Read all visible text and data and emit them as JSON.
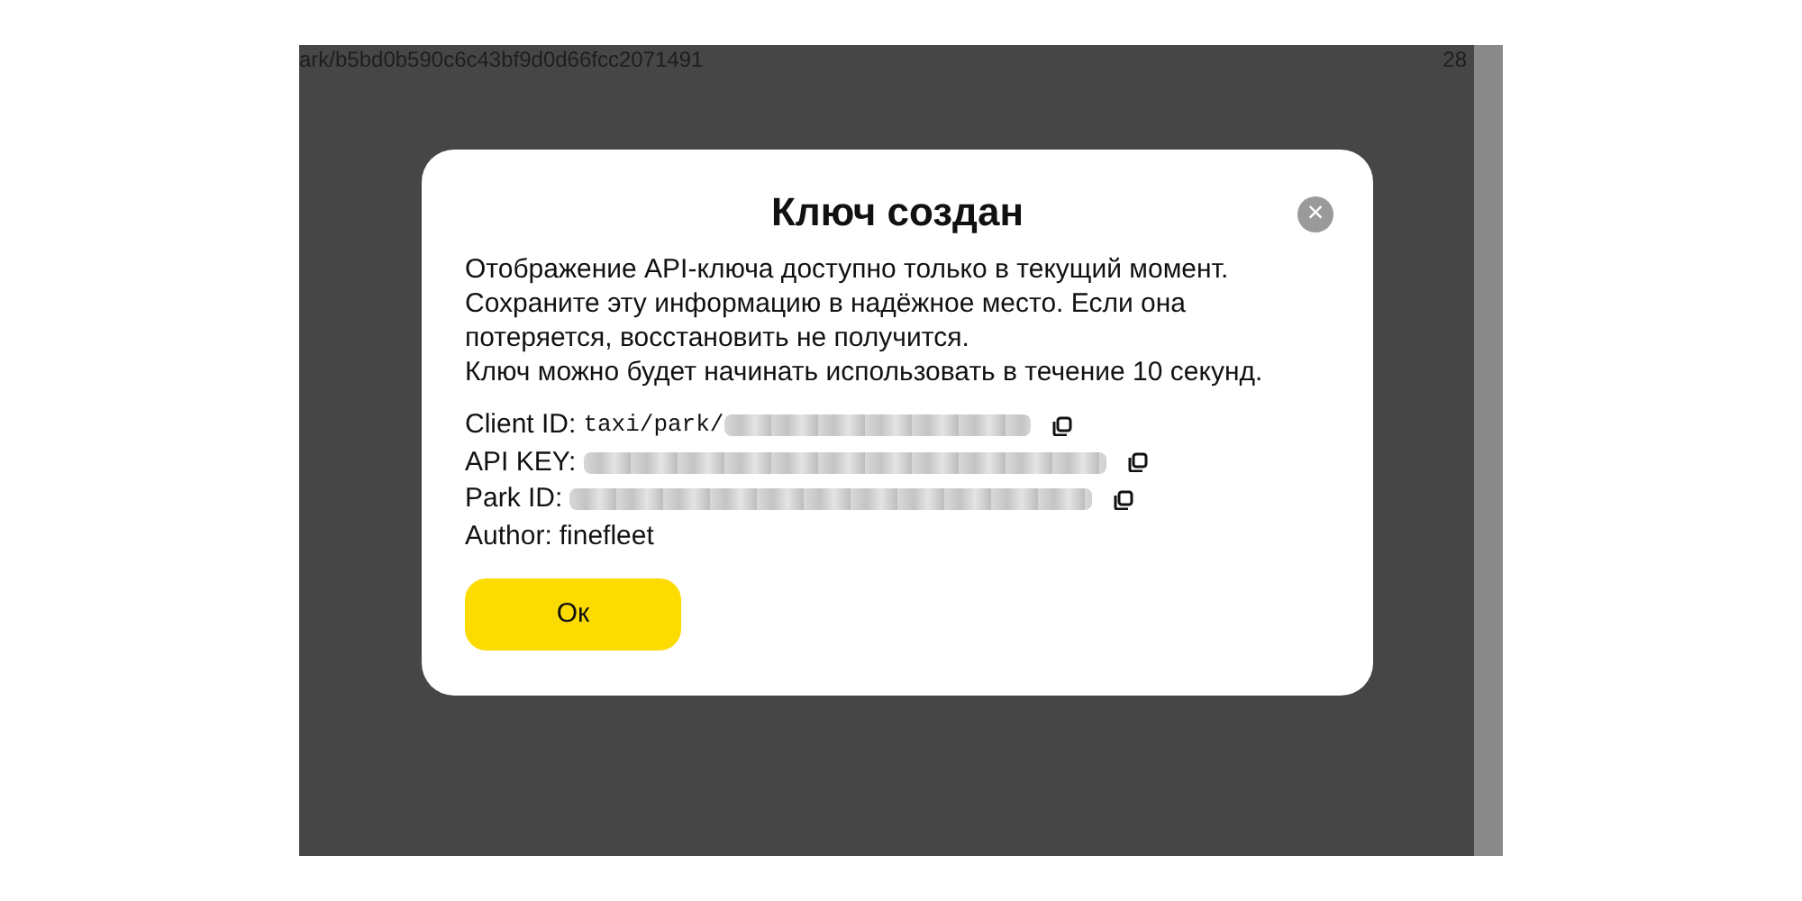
{
  "background_page": {
    "address": "ark/b5bd0b590c6c43bf9d0d66fcc2071491",
    "column_2": "28"
  },
  "dialog": {
    "title": "Ключ создан",
    "close": "×",
    "message": [
      "Отображение API-ключа доступно только в текущий момент.",
      "Сохраните эту информацию в надёжное место. Если она потеряется, восстановить не получится.",
      "Ключ можно будет начинать использовать в течение 10 секунд."
    ],
    "fields": [
      {
        "label": "Client ID:",
        "value": "taxi/park/",
        "redacted": true,
        "copyable": true
      },
      {
        "label": "API KEY:",
        "redacted": true,
        "copyable": true
      },
      {
        "label": "Park ID:",
        "redacted": true,
        "copyable": true
      },
      {
        "label": "Author:",
        "value": "finefleet",
        "redacted": false,
        "copyable": false
      }
    ],
    "button": "Ок"
  }
}
